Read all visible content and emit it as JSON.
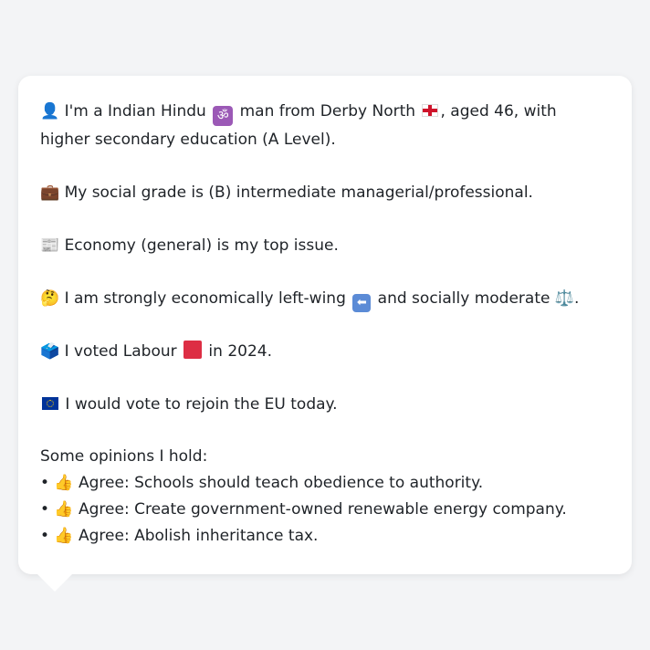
{
  "lines": {
    "identity_a": "👤 I'm a Indian Hindu ",
    "identity_om": "ॐ",
    "identity_b": " man from Derby North ",
    "identity_c": ", aged 46, with higher secondary education (A Level).",
    "social_grade": "💼 My social grade is (B) intermediate managerial/professional.",
    "top_issue": "📰 Economy (general) is my top issue.",
    "ideology_a": "🤔 I am strongly economically left-wing ",
    "ideology_arrow": "⬅",
    "ideology_b": " and socially moderate ⚖️.",
    "vote_a": "🗳️ I voted Labour ",
    "vote_b": " in 2024.",
    "eu_text": " I would vote to rejoin the EU today."
  },
  "opinions": {
    "heading": "Some opinions I hold:",
    "items": [
      "• 👍 Agree: Schools should teach obedience to authority.",
      "• 👍 Agree: Create government-owned renewable energy company.",
      "• 👍 Agree: Abolish inheritance tax."
    ]
  },
  "icons": {
    "person": "person-icon",
    "om": "om-icon",
    "england_flag": "england-flag-icon",
    "briefcase": "briefcase-icon",
    "newspaper": "newspaper-icon",
    "thinking": "thinking-face-icon",
    "left_arrow": "left-arrow-icon",
    "scales": "balance-scale-icon",
    "ballot": "ballot-box-icon",
    "labour_square": "red-square-icon",
    "eu_flag": "eu-flag-icon",
    "thumbs_up": "thumbs-up-icon"
  },
  "colors": {
    "background": "#f3f4f6",
    "bubble": "#ffffff",
    "text": "#1f2328",
    "labour_red": "#dd2e44",
    "eu_blue": "#003399"
  }
}
